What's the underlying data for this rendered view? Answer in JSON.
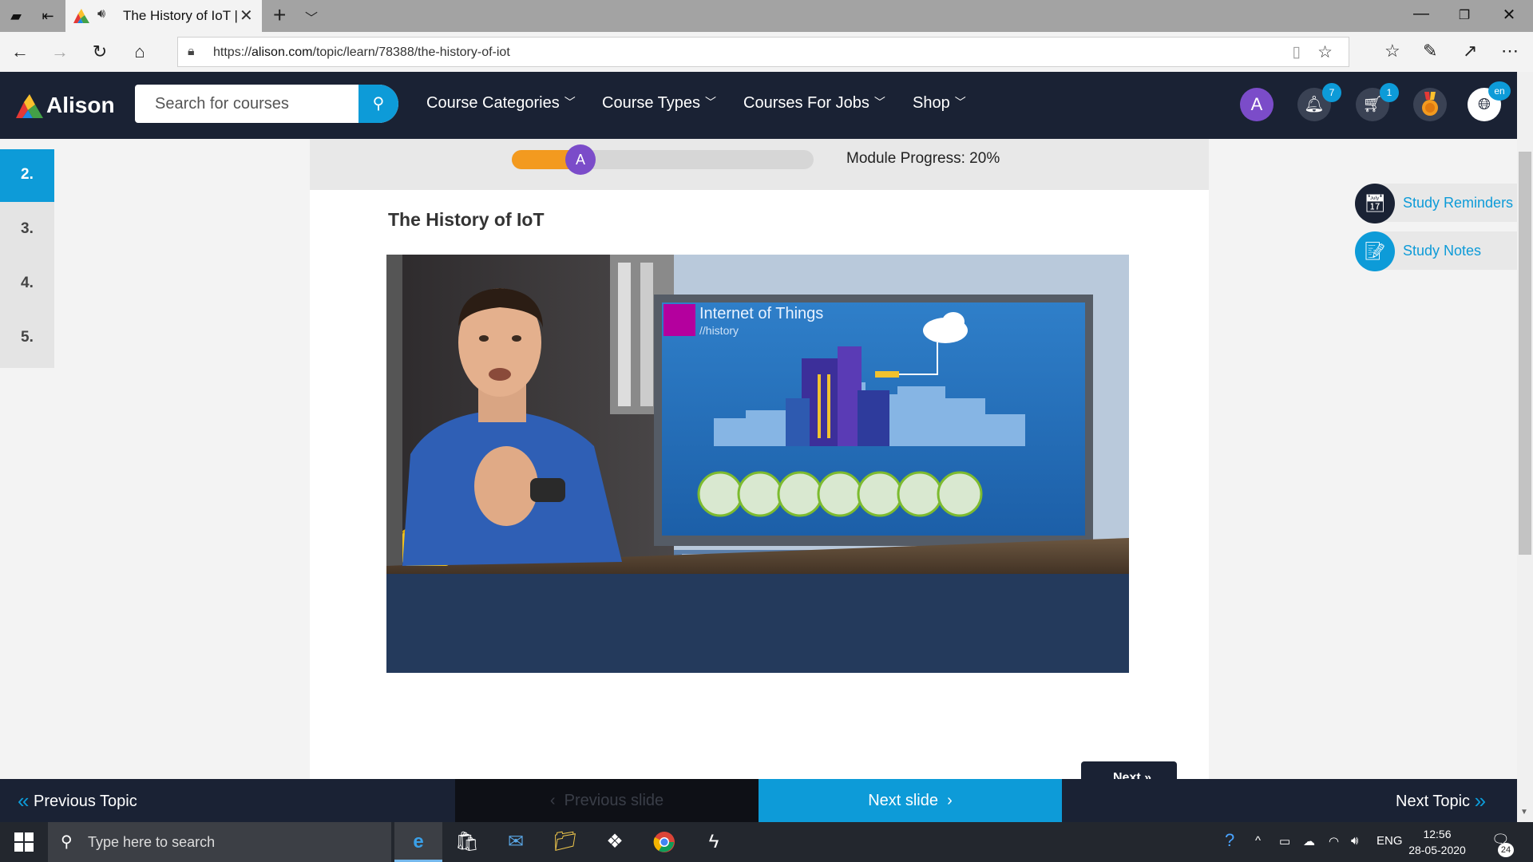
{
  "browser": {
    "tab_title": "The History of IoT |",
    "address": {
      "prefix": "https://",
      "domain": "alison.com",
      "path": "/topic/learn/78388/the-history-of-iot"
    }
  },
  "header": {
    "brand": "Alison",
    "search_placeholder": "Search for courses",
    "menu": [
      "Course Categories",
      "Course Types",
      "Courses For Jobs",
      "Shop"
    ],
    "avatar_letter": "A",
    "notifications_count": "7",
    "cart_count": "1",
    "language": "en"
  },
  "sidebar": {
    "items": [
      "2.",
      "3.",
      "4.",
      "5."
    ]
  },
  "progress": {
    "label": "Module Progress: 20%",
    "value": 0.2,
    "knob_letter": "A"
  },
  "topic": {
    "title": "The History of IoT"
  },
  "video": {
    "slide_title": "Internet of Things",
    "slide_subtitle": "//history"
  },
  "widgets": {
    "reminders": "Study Reminders",
    "notes": "Study Notes"
  },
  "next_button": "Next",
  "bottom_nav": {
    "previous_topic": "Previous Topic",
    "previous_slide": "Previous slide",
    "next_slide": "Next slide",
    "next_topic": "Next Topic"
  },
  "taskbar": {
    "search_placeholder": "Type here to search",
    "language": "ENG",
    "time": "12:56",
    "date": "28-05-2020",
    "notification_count": "24"
  }
}
